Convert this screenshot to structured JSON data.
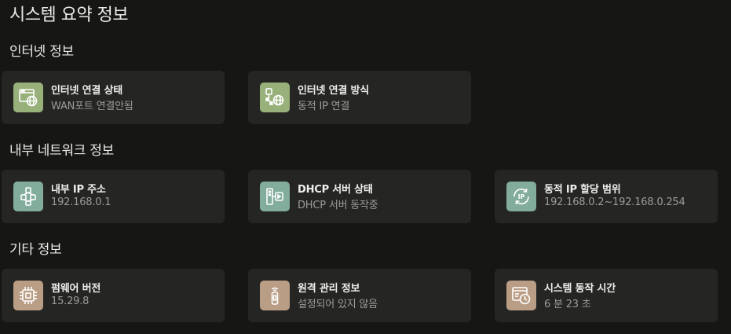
{
  "page_title": "시스템 요약 정보",
  "sections": [
    {
      "title": "인터넷 정보",
      "cards": [
        {
          "label": "인터넷 연결 상태",
          "value": "WAN포트 연결안됨",
          "icon": "internet-window-globe-icon",
          "color": "#98b07a"
        },
        {
          "label": "인터넷 연결 방식",
          "value": "동적 IP 연결",
          "icon": "network-globe-icon",
          "color": "#98b07a"
        }
      ]
    },
    {
      "title": "내부 네트워크 정보",
      "cards": [
        {
          "label": "내부 IP 주소",
          "value": "192.168.0.1",
          "icon": "network-topology-icon",
          "color": "#82ac9c"
        },
        {
          "label": "DHCP 서버 상태",
          "value": "DHCP 서버 동작중",
          "icon": "dhcp-server-icon",
          "color": "#82ac9c"
        },
        {
          "label": "동적 IP 할당 범위",
          "value": "192.168.0.2~192.168.0.254",
          "icon": "ip-refresh-icon",
          "color": "#82ac9c"
        }
      ]
    },
    {
      "title": "기타 정보",
      "cards": [
        {
          "label": "펌웨어 버전",
          "value": "15.29.8",
          "icon": "chip-icon",
          "color": "#b99d85"
        },
        {
          "label": "원격 관리 정보",
          "value": "설정되어 있지 않음",
          "icon": "remote-control-icon",
          "color": "#b99d85"
        },
        {
          "label": "시스템 동작 시간",
          "value": "6 분 23 초",
          "icon": "uptime-clock-icon",
          "color": "#b99d85"
        }
      ]
    }
  ]
}
